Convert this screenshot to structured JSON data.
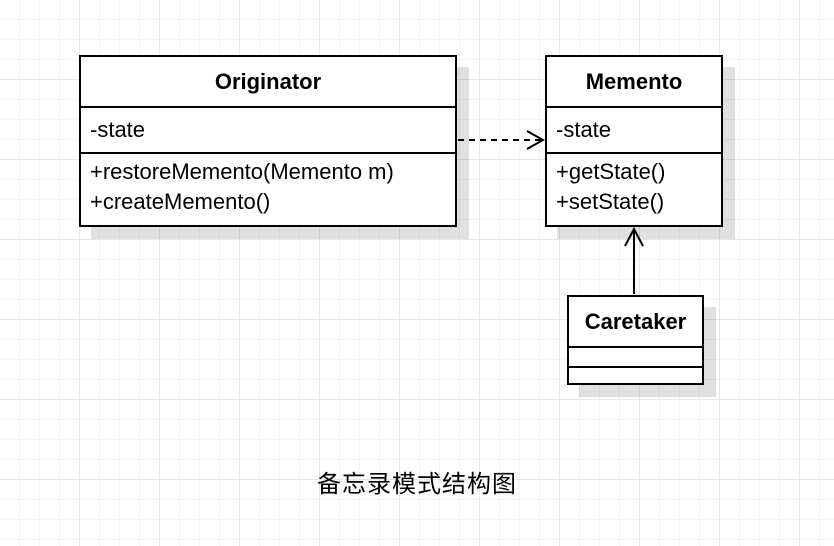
{
  "classes": {
    "originator": {
      "name": "Originator",
      "attributes": [
        "-state"
      ],
      "operations": [
        "+restoreMemento(Memento m)",
        "+createMemento()"
      ]
    },
    "memento": {
      "name": "Memento",
      "attributes": [
        "-state"
      ],
      "operations": [
        "+getState()",
        "+setState()"
      ]
    },
    "caretaker": {
      "name": "Caretaker",
      "attributes": [],
      "operations": []
    }
  },
  "relations": [
    {
      "from": "Originator",
      "to": "Memento",
      "type": "dependency"
    },
    {
      "from": "Caretaker",
      "to": "Memento",
      "type": "association"
    }
  ],
  "caption": "备忘录模式结构图"
}
